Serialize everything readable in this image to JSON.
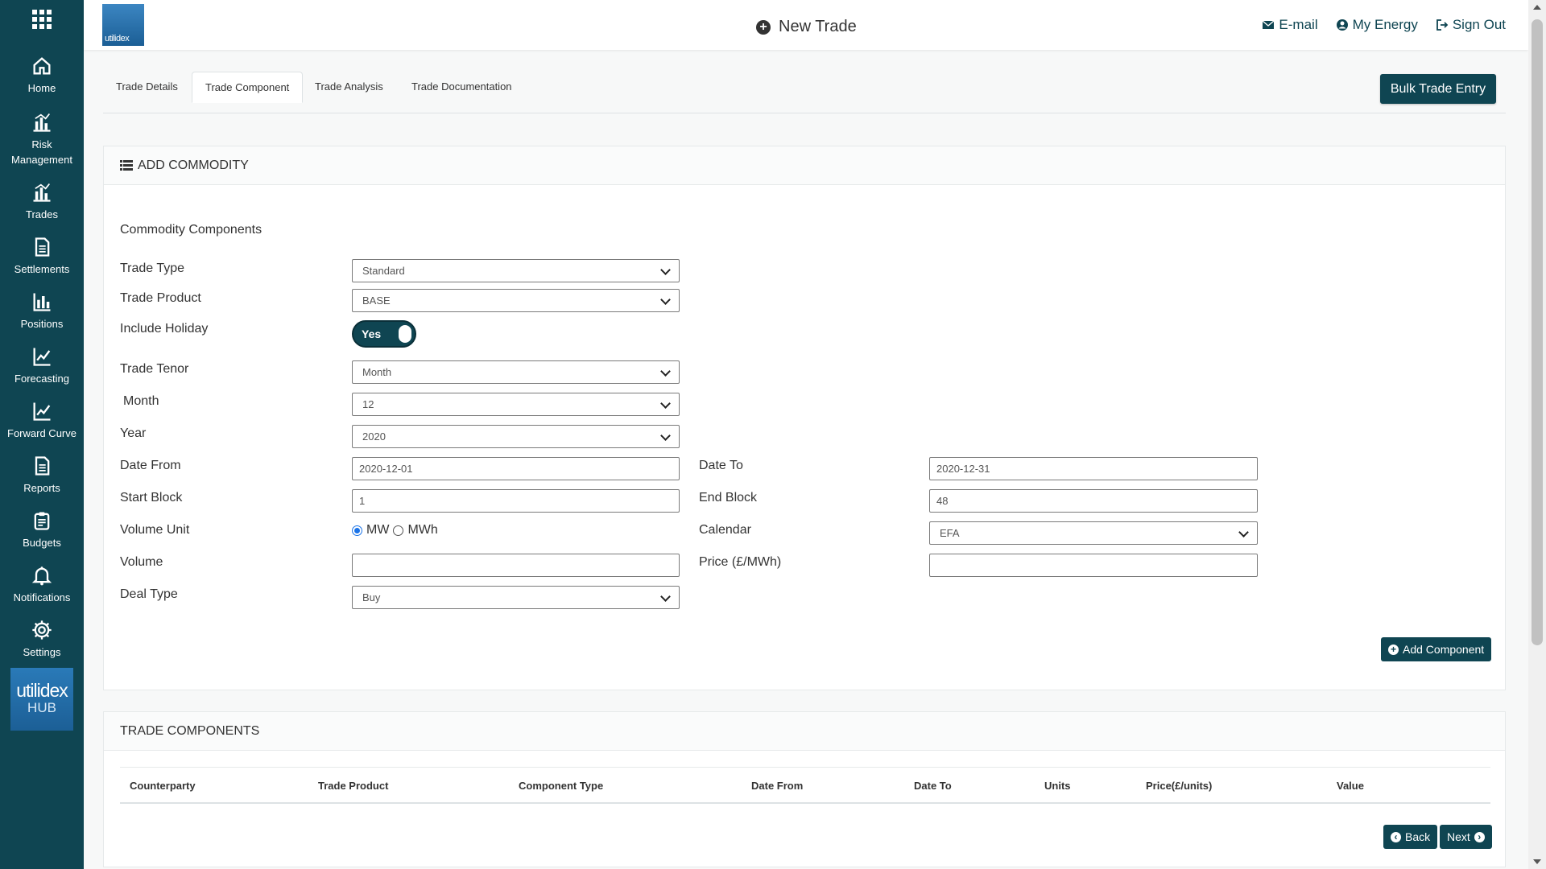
{
  "sidebar": {
    "items": [
      {
        "label": "Home",
        "icon": "home-icon"
      },
      {
        "label": "Risk Management",
        "icon": "bar-chart-icon"
      },
      {
        "label": "Trades",
        "icon": "bar-chart-icon"
      },
      {
        "label": "Settlements",
        "icon": "document-icon"
      },
      {
        "label": "Positions",
        "icon": "column-chart-icon"
      },
      {
        "label": "Forecasting",
        "icon": "line-chart-icon"
      },
      {
        "label": "Forward Curve",
        "icon": "line-chart-icon"
      },
      {
        "label": "Reports",
        "icon": "document-icon"
      },
      {
        "label": "Budgets",
        "icon": "clipboard-icon"
      },
      {
        "label": "Notifications",
        "icon": "bell-icon"
      },
      {
        "label": "Settings",
        "icon": "gear-icon"
      }
    ],
    "hub_logo_top": "utilidex",
    "hub_logo_bottom": "HUB"
  },
  "header": {
    "brand": "utilidex",
    "title": "New Trade",
    "links": {
      "email": "E-mail",
      "my_energy": "My Energy",
      "sign_out": "Sign Out"
    }
  },
  "tabs": [
    "Trade Details",
    "Trade Component",
    "Trade Analysis",
    "Trade Documentation"
  ],
  "active_tab": "Trade Component",
  "bulk_button": "Bulk Trade Entry",
  "add_commodity": {
    "title": "ADD COMMODITY",
    "section_label": "Commodity Components",
    "labels": {
      "trade_type": "Trade Type",
      "trade_product": "Trade Product",
      "include_holiday": "Include Holiday",
      "trade_tenor": "Trade Tenor",
      "month": "Month",
      "year": "Year",
      "date_from": "Date From",
      "date_to": "Date To",
      "start_block": "Start Block",
      "end_block": "End Block",
      "volume_unit": "Volume Unit",
      "calendar": "Calendar",
      "volume": "Volume",
      "price": "Price (£/MWh)",
      "deal_type": "Deal Type"
    },
    "values": {
      "trade_type": "Standard",
      "trade_product": "BASE",
      "include_holiday": "Yes",
      "trade_tenor": "Month",
      "month": "12",
      "year": "2020",
      "date_from": "2020-12-01",
      "date_to": "2020-12-31",
      "start_block": "1",
      "end_block": "48",
      "volume_unit_mw": "MW",
      "volume_unit_mwh": "MWh",
      "calendar": "EFA",
      "volume": "",
      "price": "",
      "deal_type": "Buy"
    },
    "add_button": "Add Component"
  },
  "trade_components": {
    "title": "TRADE COMPONENTS",
    "columns": [
      "Counterparty",
      "Trade Product",
      "Component Type",
      "Date From",
      "Date To",
      "Units",
      "Price(£/units)",
      "Value"
    ],
    "rows": [],
    "back_button": "Back",
    "next_button": "Next"
  },
  "colors": {
    "primary": "#0f4552",
    "sidebar": "#0f4552",
    "brand_blue": "#1b5e95"
  }
}
